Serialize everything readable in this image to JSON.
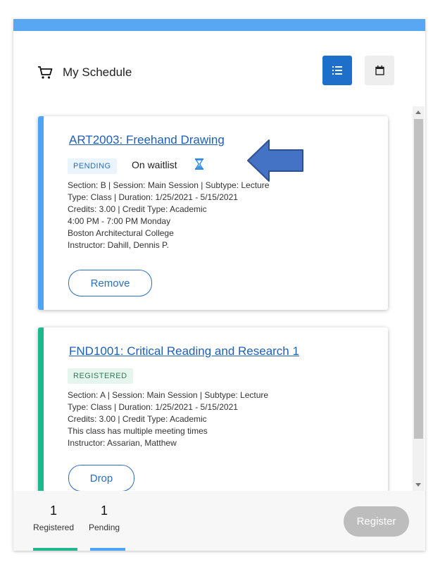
{
  "header": {
    "title": "My Schedule",
    "icon": "cart-icon"
  },
  "view_toggle": {
    "list_icon": "list-icon",
    "calendar_icon": "calendar-icon",
    "active": "list"
  },
  "courses": [
    {
      "title": "ART2003: Freehand Drawing",
      "status": "PENDING",
      "waitlist": "On waitlist",
      "details": [
        "Section: B | Session: Main Session | Subtype: Lecture",
        "Type: Class | Duration: 1/25/2021 - 5/15/2021",
        "Credits: 3.00 | Credit Type: Academic",
        "4:00 PM - 7:00 PM Monday",
        "Boston Architectural College",
        "Instructor: Dahill, Dennis P."
      ],
      "action": "Remove"
    },
    {
      "title": "FND1001: Critical Reading and Research 1",
      "status": "REGISTERED",
      "details": [
        "Section: A | Session: Main Session | Subtype: Lecture",
        "Type: Class | Duration: 1/25/2021 - 5/15/2021",
        "Credits: 3.00 | Credit Type: Academic",
        "This class has multiple meeting times",
        "Instructor: Assarian, Matthew"
      ],
      "action": "Drop"
    }
  ],
  "footer": {
    "registered_count": "1",
    "registered_label": "Registered",
    "pending_count": "1",
    "pending_label": "Pending",
    "register_button": "Register"
  },
  "colors": {
    "accent": "#1e6fc9",
    "pending": "#4ea5f5",
    "registered": "#1fb88e",
    "arrow": "#4472c4"
  }
}
